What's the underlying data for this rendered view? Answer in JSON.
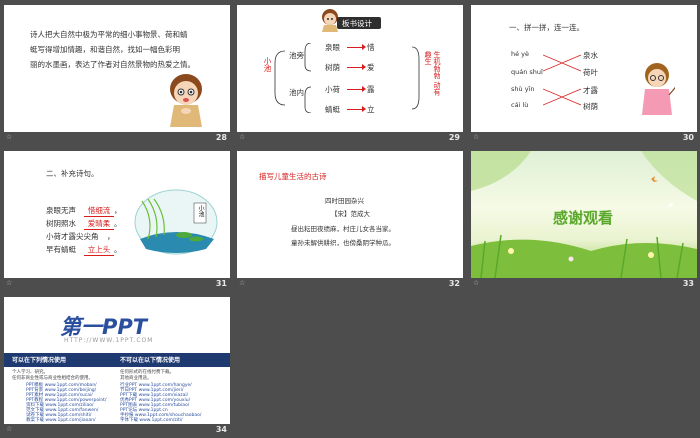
{
  "slides": {
    "s28": {
      "number": "28",
      "star": "☆",
      "text_lines": [
        "诗人把大自然中极为平常的细小事物景、荷和蜻",
        "蜓写得增加情趣，和谐自然，找如一幅色彩明",
        "丽的水墨画，表达了作者对自然景物的热爱之情。"
      ]
    },
    "s29": {
      "number": "29",
      "star": "☆",
      "banner": "板书设计",
      "left_title": "小池",
      "group_a": "池旁",
      "group_b": "池内",
      "items": [
        "泉眼",
        "树荫",
        "小荷",
        "蜻蜓"
      ],
      "results": [
        "惜",
        "爱",
        "露",
        "立"
      ],
      "right_title": "生机勃勃 动有趣生"
    },
    "s30": {
      "number": "30",
      "star": "☆",
      "heading": "一、拼一拼，连一连。",
      "pinyin": [
        "hé yè",
        "quán shuǐ",
        "shù yīn",
        "cái lù"
      ],
      "words": [
        "泉水",
        "荷叶",
        "才露",
        "树荫"
      ]
    },
    "s31": {
      "number": "31",
      "star": "☆",
      "heading": "二、补充诗句。",
      "lines": [
        {
          "prefix": "泉眼无声",
          "answer": "惜细流",
          "suffix": "，"
        },
        {
          "prefix": "树阴照水",
          "answer": "爱晴柔",
          "suffix": "。"
        },
        {
          "prefix": "小荷才露尖尖角",
          "answer": "",
          "suffix": "，"
        },
        {
          "prefix": "早有蜻蜓",
          "answer": "立上头",
          "suffix": "。"
        }
      ],
      "picture_label": "小池"
    },
    "s32": {
      "number": "32",
      "star": "☆",
      "heading": "描写儿童生活的古诗",
      "poem_title": "四时田园杂兴",
      "author": "【宋】范成大",
      "lines": [
        "昼出耘田夜绩麻，村庄儿女各当家。",
        "童孙未解供耕织，也傍桑阴学种瓜。"
      ]
    },
    "s33": {
      "number": "33",
      "star": "☆",
      "title": "感谢观看"
    },
    "s34": {
      "number": "34",
      "star": "☆",
      "logo": "第一PPT",
      "url": "HTTP://WWW.1PPT.COM",
      "col1_title": "可以在下列情况使用",
      "col2_title": "不可以在以下情况使用",
      "col1_sub": [
        "个人学习、研究。",
        "任何非商业性或与商业性相结合的使用。"
      ],
      "col2_sub": [
        "任何形式的在线付费下载。",
        "其他商业用途。"
      ],
      "col1_items": [
        "PPT模板 www.1ppt.com/moban/",
        "PPT背景 www.1ppt.com/beijing/",
        "PPT素材 www.1ppt.com/sucai/",
        "PPT教程 www.1ppt.com/powerpoint/",
        "资料下载 www.1ppt.com/ziliao/",
        "范文下载 www.1ppt.com/fanwen/",
        "试卷下载 www.1ppt.com/shiti/",
        "教案下载 www.1ppt.com/jiaoan/"
      ],
      "col2_items": [
        "行业PPT www.1ppt.com/hangye/",
        "节日PPT www.1ppt.com/jieri/",
        "PPT下载 www.1ppt.com/xiazai/",
        "优秀PPT www.1ppt.com/youxiu/",
        "PPT图表 www.1ppt.com/tubiao/",
        "PPT论坛 www.1ppt.cn",
        "手抄报 www.1ppt.com/shouchaobao/",
        "字体下载 www.1ppt.com/ziti/"
      ]
    }
  },
  "colors": {
    "bg": "#4d4d4d",
    "red": "#d81e1e",
    "blue": "#2b4f9f",
    "navy": "#1f3a70",
    "green": "#5aa82b"
  }
}
